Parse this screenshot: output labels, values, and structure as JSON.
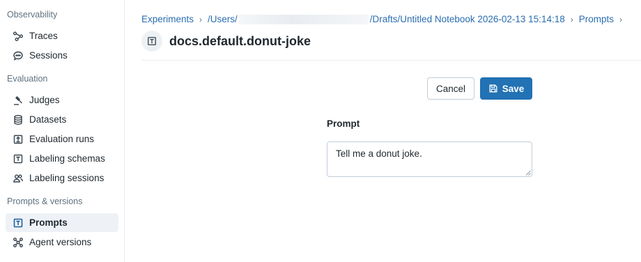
{
  "sidebar": {
    "sections": [
      {
        "label": "Observability"
      },
      {
        "label": "Evaluation"
      },
      {
        "label": "Prompts & versions"
      }
    ],
    "items": [
      {
        "label": "Traces",
        "icon": "traces-icon"
      },
      {
        "label": "Sessions",
        "icon": "chat-bubble-icon"
      },
      {
        "label": "Judges",
        "icon": "gavel-icon"
      },
      {
        "label": "Datasets",
        "icon": "database-icon"
      },
      {
        "label": "Evaluation runs",
        "icon": "upload-box-icon"
      },
      {
        "label": "Labeling schemas",
        "icon": "text-box-icon"
      },
      {
        "label": "Labeling sessions",
        "icon": "users-icon"
      },
      {
        "label": "Prompts",
        "icon": "text-box-icon",
        "active": true
      },
      {
        "label": "Agent versions",
        "icon": "model-graph-icon"
      }
    ]
  },
  "breadcrumb": {
    "items": [
      "Experiments",
      "/Users/",
      "/Drafts/Untitled Notebook 2026-02-13 15:14:18",
      "Prompts"
    ]
  },
  "header": {
    "title": "docs.default.donut-joke",
    "icon": "text-box-icon"
  },
  "actions": {
    "cancel_label": "Cancel",
    "save_label": "Save"
  },
  "form": {
    "prompt_label": "Prompt",
    "prompt_value": "Tell me a donut joke."
  },
  "colors": {
    "accent": "#2272b4",
    "link": "#2a6db0",
    "active_bg": "#eef2f6"
  }
}
